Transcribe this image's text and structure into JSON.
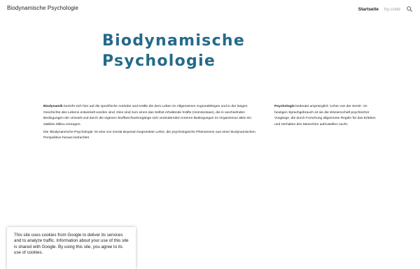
{
  "header": {
    "site_title": "Biodynamische Psychologie",
    "nav": [
      {
        "label": "Startseite",
        "active": true
      },
      {
        "label": "try-code",
        "active": false
      }
    ],
    "search_icon": "search-icon"
  },
  "hero": {
    "title_line1": "Biodynamische",
    "title_line2": "Psychologie",
    "color": "#256a8a"
  },
  "left_column": {
    "p1_term": "Biodynamik",
    "p1_text": " bezieht sich hier auf die spezifische Antriebe und Kräfte die dem Leben im Allgemeinen zugrundeliegen und in der langen Geschichte des Lebens entwickelt worden sind.  Dies sind zum einen das Selbst erhaltende Kräfte (Homöostase), die in wechselnden Bedingungen der Umwelt und durch die eigenen Stoffwechselvorgänge sich verändernden inneren Bedingungen im Organismus aktiv ein stabiles Milieu erzeugen.",
    "p2_text": "Die 'Biodynamische Psychologie' ist eine von Gerda Boyesen begründete Lehre, die psychologische Phänomene aus einer biodynamischen Perspektive heraus betrachtet."
  },
  "right_column": {
    "term": "Psychologie",
    "text": " bedeutet ursprünglich 'Lehre von der Seele'.  Im heutigen Sprachgebrauch ist sie die Wissenschaft psychischer Vorgänge, die durch Forschung allgemeine Regeln für das Erleben und Verhalten des Menschen aufzustellen sucht."
  },
  "cookie_banner": {
    "text": "This site uses cookies from Google to deliver its services and to analyze traffic. Information about your use of this site is shared with Google. By using this site, you agree to its use of cookies."
  }
}
